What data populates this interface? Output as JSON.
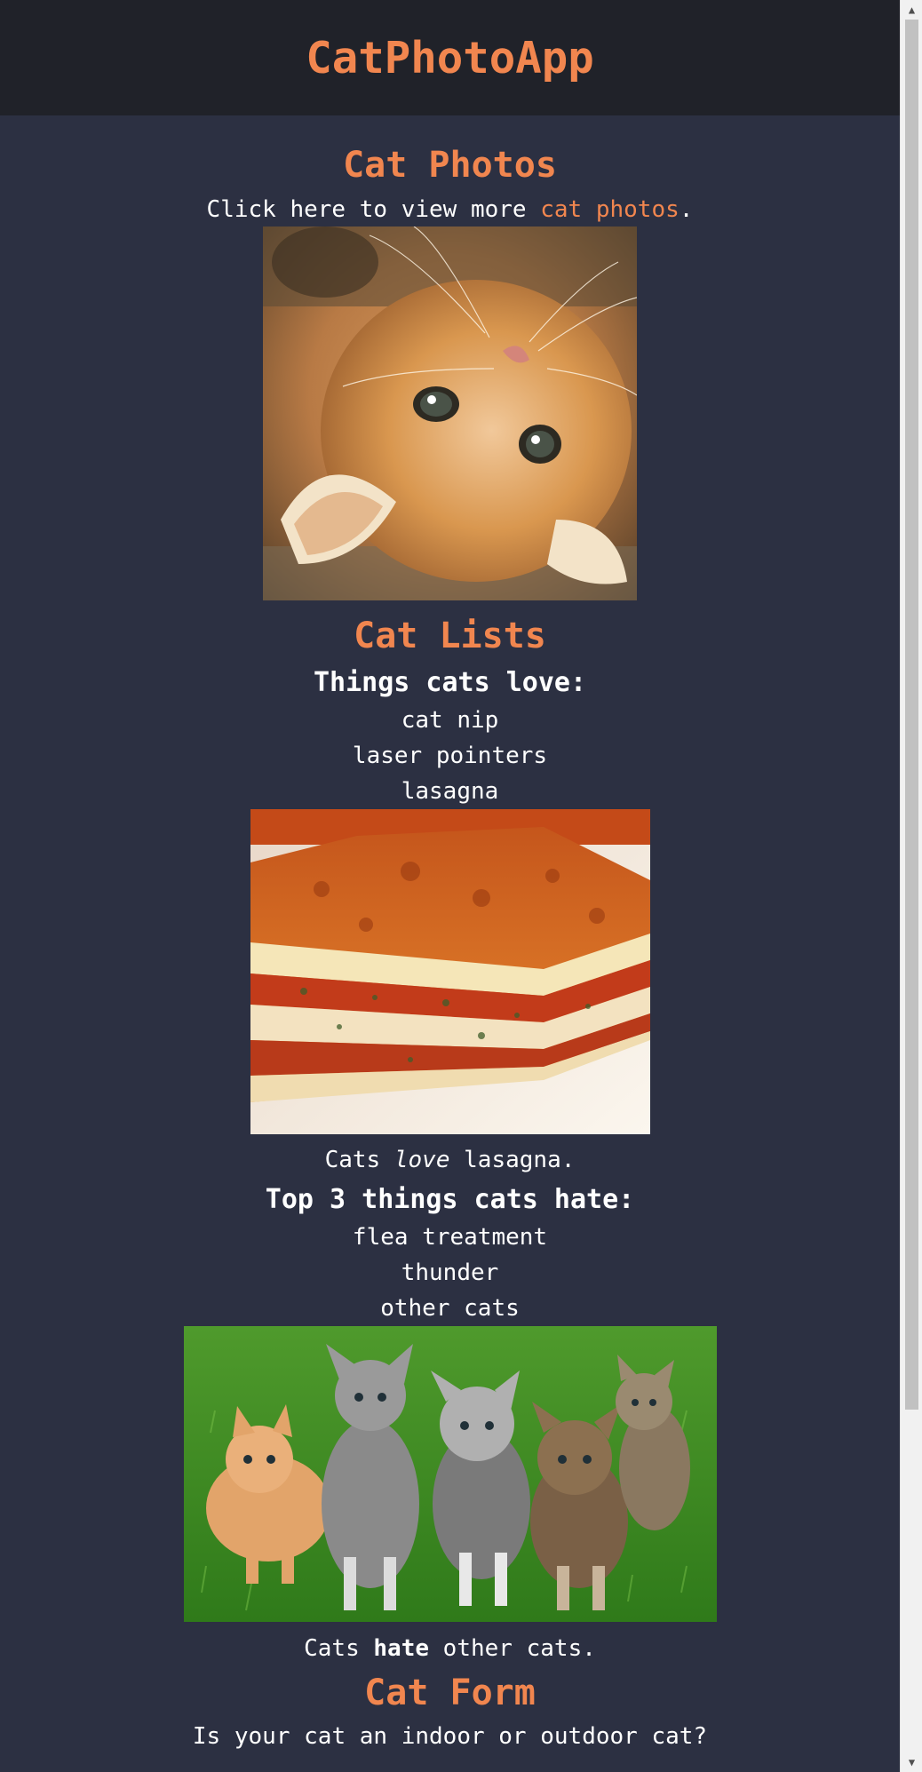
{
  "header": {
    "title": "CatPhotoApp"
  },
  "photos_section": {
    "heading": "Cat Photos",
    "text_before": "Click here to view more ",
    "link_text": "cat photos",
    "text_after": "."
  },
  "lists_section": {
    "heading": "Cat Lists",
    "love_heading": "Things cats love:",
    "love_items": [
      "cat nip",
      "laser pointers",
      "lasagna"
    ],
    "love_caption_before": "Cats ",
    "love_caption_em": "love",
    "love_caption_after": " lasagna.",
    "hate_heading": "Top 3 things cats hate:",
    "hate_items": [
      "flea treatment",
      "thunder",
      "other cats"
    ],
    "hate_caption_before": "Cats ",
    "hate_caption_strong": "hate",
    "hate_caption_after": " other cats."
  },
  "form_section": {
    "heading": "Cat Form",
    "question": "Is your cat an indoor or outdoor cat?"
  },
  "colors": {
    "accent": "#f1864f",
    "background": "#2c3042",
    "header_bg": "#202229",
    "text": "#ffffff"
  }
}
